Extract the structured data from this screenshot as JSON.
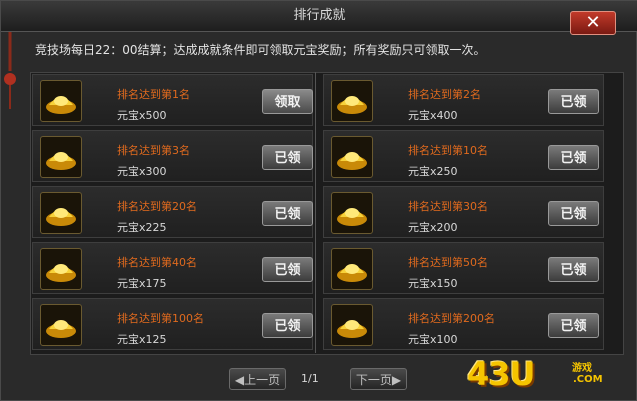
{
  "window": {
    "title": "排行成就",
    "close_label": "✕"
  },
  "notice": "竞技场每日22：00结算；达成成就条件即可领取元宝奖励；所有奖励只可领取一次。",
  "rows_left": [
    {
      "name": "排名达到第1名",
      "reward": "元宝x500",
      "button": "领取"
    },
    {
      "name": "排名达到第3名",
      "reward": "元宝x300",
      "button": "已领"
    },
    {
      "name": "排名达到第20名",
      "reward": "元宝x225",
      "button": "已领"
    },
    {
      "name": "排名达到第40名",
      "reward": "元宝x175",
      "button": "已领"
    },
    {
      "name": "排名达到第100名",
      "reward": "元宝x125",
      "button": "已领"
    }
  ],
  "rows_right": [
    {
      "name": "排名达到第2名",
      "reward": "元宝x400",
      "button": "已领"
    },
    {
      "name": "排名达到第10名",
      "reward": "元宝x250",
      "button": "已领"
    },
    {
      "name": "排名达到第30名",
      "reward": "元宝x200",
      "button": "已领"
    },
    {
      "name": "排名达到第50名",
      "reward": "元宝x150",
      "button": "已领"
    },
    {
      "name": "排名达到第200名",
      "reward": "元宝x100",
      "button": "已领"
    }
  ],
  "pager": {
    "prev": "上一页",
    "next": "下一页",
    "info": "1/1"
  },
  "logo": {
    "text": "43U",
    "small": "游戏",
    "com": ".COM"
  }
}
